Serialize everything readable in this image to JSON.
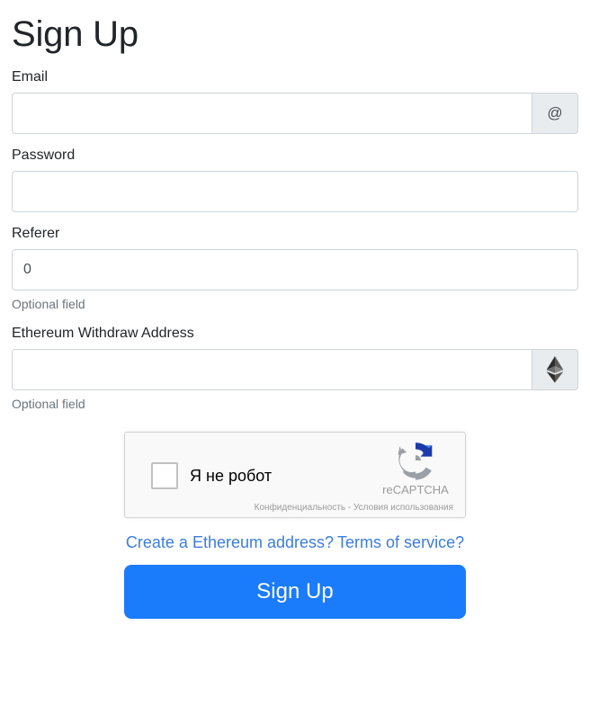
{
  "page": {
    "title": "Sign Up"
  },
  "fields": {
    "email": {
      "label": "Email",
      "value": "",
      "placeholder": "",
      "addon_icon": "at-sign-icon",
      "addon_glyph": "@"
    },
    "password": {
      "label": "Password",
      "value": "",
      "placeholder": ""
    },
    "referer": {
      "label": "Referer",
      "value": "0",
      "placeholder": "",
      "help": "Optional field"
    },
    "withdraw_address": {
      "label": "Ethereum Withdraw Address",
      "value": "",
      "placeholder": "",
      "help": "Optional field",
      "addon_icon": "ethereum-icon"
    }
  },
  "recaptcha": {
    "checkbox_label": "Я не робот",
    "brand_name": "reCAPTCHA",
    "privacy_label": "Конфиденциальность",
    "footer_separator": " - ",
    "terms_label": "Условия использования",
    "logo_icon": "recaptcha-logo-icon"
  },
  "links": {
    "create_address": "Create a Ethereum address?",
    "terms_of_service": "Terms of service?"
  },
  "submit": {
    "label": "Sign Up"
  },
  "colors": {
    "accent": "#1a7bfb",
    "link": "#3b7ddd",
    "muted": "#6c757d",
    "border": "#ced4da",
    "addon_bg": "#e9ecef",
    "recaptcha_bg": "#f9f9f9",
    "recaptcha_blue": "#1c3aa9",
    "recaptcha_blue_light": "#4285f4",
    "recaptcha_gray": "#9aa0a6"
  }
}
